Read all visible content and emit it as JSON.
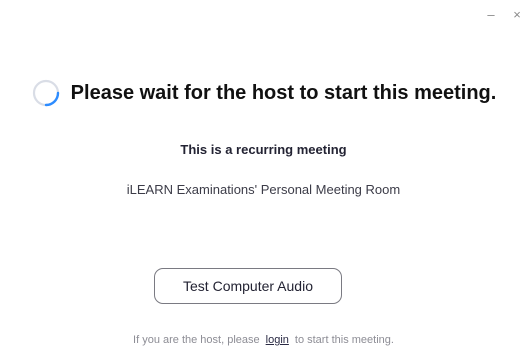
{
  "window": {
    "minimize_glyph": "–",
    "close_glyph": "×"
  },
  "main": {
    "heading": "Please wait for the host to start this meeting.",
    "recurring_text": "This is a recurring meeting",
    "room_name": "iLEARN Examinations' Personal Meeting Room",
    "test_audio_label": "Test Computer Audio"
  },
  "footer": {
    "prefix": "If you are the host, please",
    "login_label": "login",
    "suffix": "to start this meeting."
  },
  "icons": {
    "spinner": "loading-spinner-icon"
  },
  "colors": {
    "spinner_track": "#d9dde6",
    "spinner_arc": "#2d8cff",
    "link": "#2a2a44"
  }
}
